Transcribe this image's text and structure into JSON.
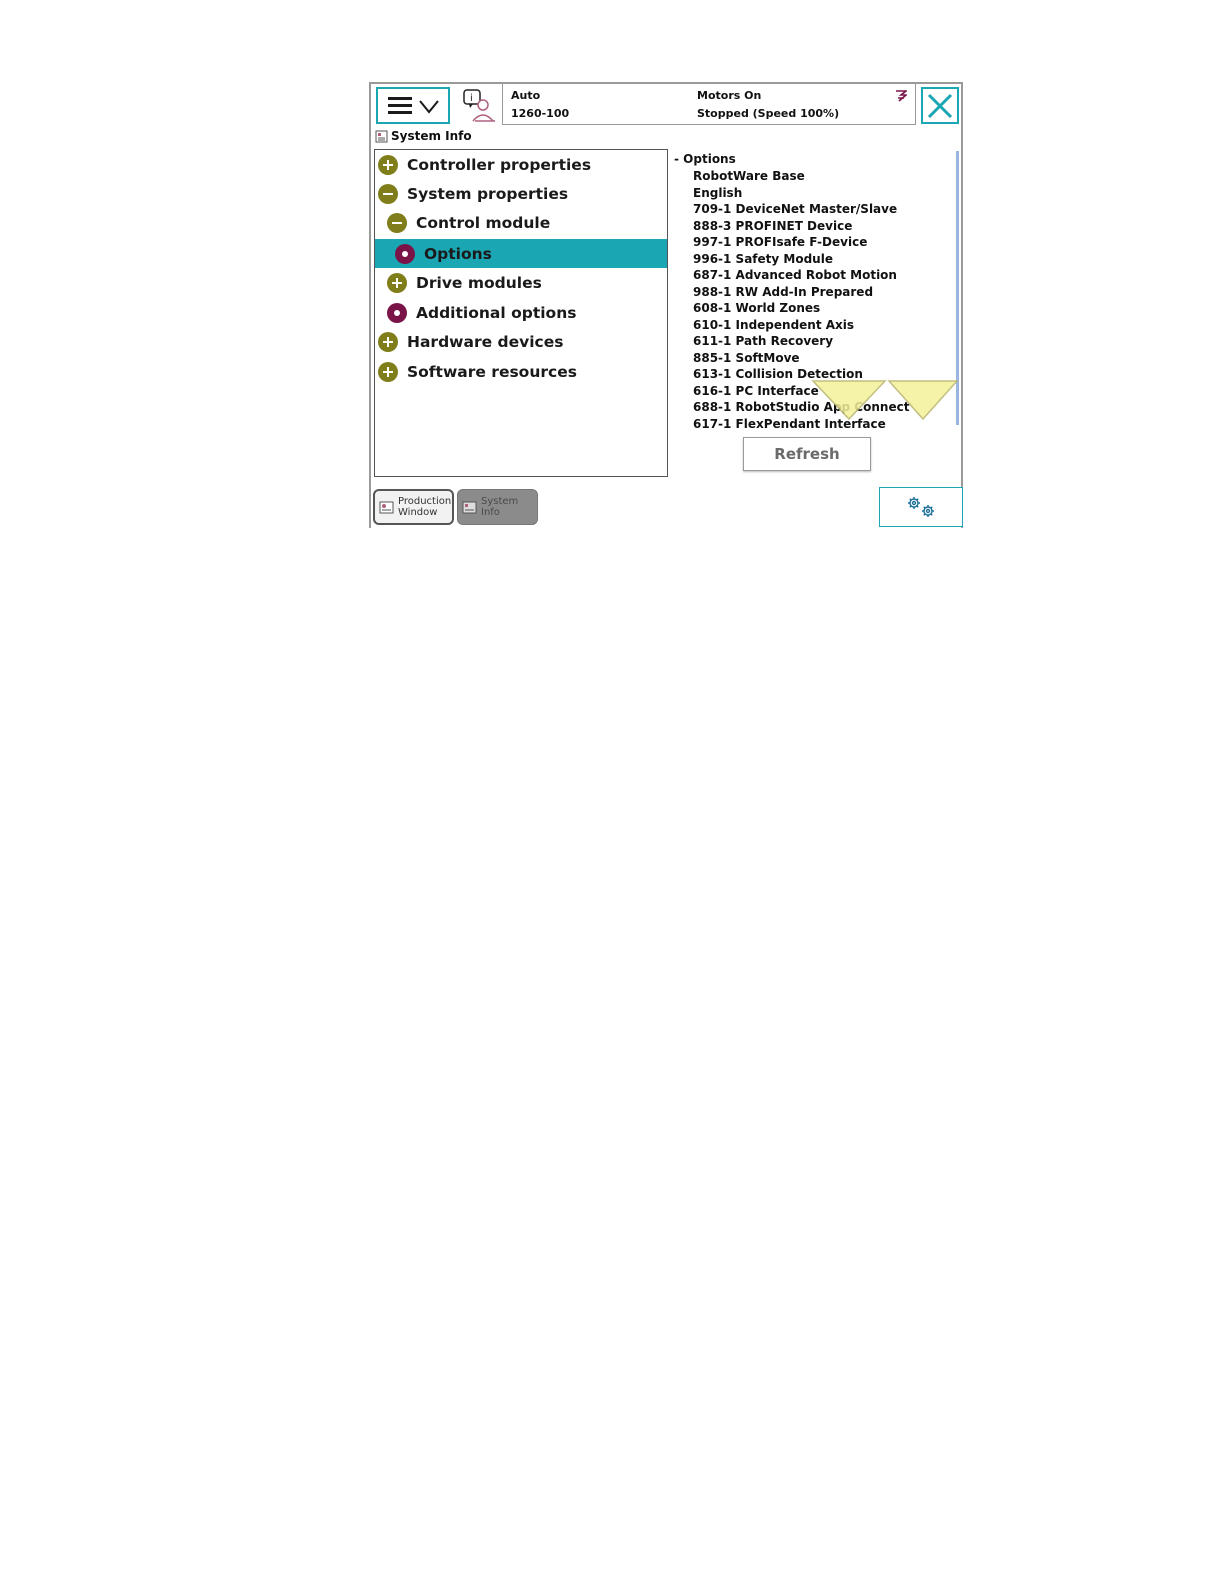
{
  "header": {
    "mode": "Auto",
    "robot": "1260-100",
    "motors": "Motors On",
    "state": "Stopped (Speed 100%)"
  },
  "app_title": "System Info",
  "tree": {
    "items": [
      {
        "label": "Controller properties",
        "icon": "plus-icon"
      },
      {
        "label": "System properties",
        "icon": "minus-icon"
      },
      {
        "label": "Control module",
        "icon": "minus-icon"
      },
      {
        "label": "Options",
        "icon": "dot-icon"
      },
      {
        "label": "Drive modules",
        "icon": "plus-icon"
      },
      {
        "label": "Additional options",
        "icon": "dot-icon"
      },
      {
        "label": "Hardware devices",
        "icon": "plus-icon"
      },
      {
        "label": "Software resources",
        "icon": "plus-icon"
      }
    ]
  },
  "options": {
    "header": "Options",
    "items": [
      "RobotWare Base",
      "English",
      "709-1 DeviceNet Master/Slave",
      "888-3 PROFINET Device",
      "997-1 PROFIsafe F-Device",
      "996-1 Safety Module",
      "687-1 Advanced Robot Motion",
      "988-1 RW Add-In Prepared",
      "608-1 World Zones",
      "610-1 Independent Axis",
      "611-1 Path Recovery",
      "885-1 SoftMove",
      "613-1 Collision Detection",
      "616-1 PC Interface",
      "688-1 RobotStudio App Connect",
      "617-1 FlexPendant Interface"
    ]
  },
  "refresh_label": "Refresh",
  "tabs": {
    "production_line1": "Production",
    "production_line2": "Window",
    "system": "System Info"
  },
  "colors": {
    "accent": "#1aa6b3",
    "tree_icon": "#7f7e1a",
    "dot_icon": "#7a1448",
    "scroll_arrow": "#f4f19a"
  }
}
